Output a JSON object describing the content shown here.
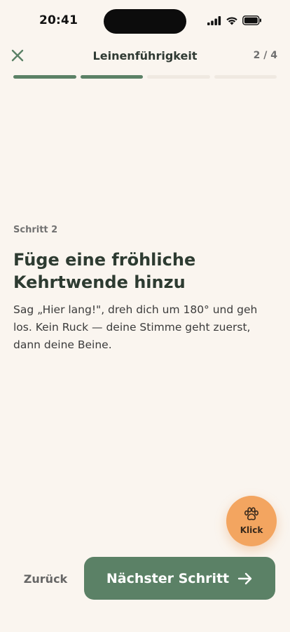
{
  "status_bar": {
    "time": "20:41"
  },
  "header": {
    "title": "Leinenführigkeit",
    "step_counter": "2 / 4",
    "close_icon": "close-icon"
  },
  "progress": {
    "total_segments": 4,
    "completed_segments": 2,
    "fill_color": "#5b8166",
    "track_color": "#efe9e1"
  },
  "content": {
    "step_label": "Schritt 2",
    "headline": "Füge eine fröhliche Kehrtwende hinzu",
    "body": "Sag „Hier lang!\", dreh dich um 180° und geh los. Kein Ruck — deine Stimme geht zuerst, dann deine Beine."
  },
  "clicker": {
    "label": "Klick",
    "icon": "paw-icon",
    "color": "#f3a560"
  },
  "footer": {
    "back_label": "Zurück",
    "next_label": "Nächster Schritt",
    "next_icon": "arrow-right-icon",
    "accent": "#5b8166"
  }
}
